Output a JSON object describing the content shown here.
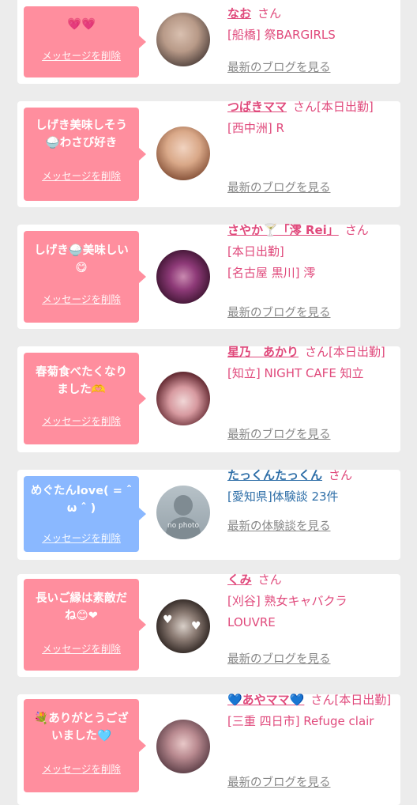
{
  "common": {
    "delete_label": "メッセージを削除",
    "san_label": "さん",
    "more_blog": "最新のブログを見る",
    "more_review": "最新の体験談を見る"
  },
  "cards": [
    {
      "message": "💗💗",
      "name": "なお",
      "status": "",
      "shop": "[船橋] 祭BARGIRLS",
      "more": "最新のブログを見る",
      "bubble_color": "#ff8e9e"
    },
    {
      "message": "しげき美味しそう🍚わさび好き",
      "name": "つばきママ",
      "status": "[本日出勤]",
      "shop": "[西中洲] R",
      "more": "最新のブログを見る",
      "bubble_color": "#ff8e9e"
    },
    {
      "message": "しげき🍚美味しい😋",
      "name": "さやか🍸「澪 Rei」",
      "status": "[本日出勤]",
      "shop": "[名古屋 黒川] 澪",
      "more": "最新のブログを見る",
      "bubble_color": "#ff8e9e"
    },
    {
      "message": "春菊食べたくなりました🫶",
      "name": "星乃　あかり",
      "status": "[本日出勤]",
      "shop": "[知立] NIGHT CAFE 知立",
      "more": "最新のブログを見る",
      "bubble_color": "#ff8e9e"
    },
    {
      "message": "めぐたんlove( = ˆ ω ˆ )",
      "name": "たっくんたっくん",
      "status": "",
      "shop": "[愛知県]体験談 23件",
      "more": "最新の体験談を見る",
      "bubble_color": "#8ab8ff",
      "avatar_text": "no photo"
    },
    {
      "message": "長いご縁は素敵だね😊❤",
      "name": "くみ",
      "status": "",
      "shop": "[刈谷] 熟女キャバクラ LOUVRE",
      "more": "最新のブログを見る",
      "bubble_color": "#ff8e9e"
    },
    {
      "message": "💐ありがとうございました🩵",
      "name": "💙あやママ💙",
      "status": "[本日出勤]",
      "shop": "[三重 四日市] Refuge clair",
      "more": "最新のブログを見る",
      "bubble_color": "#ff8e9e"
    }
  ]
}
